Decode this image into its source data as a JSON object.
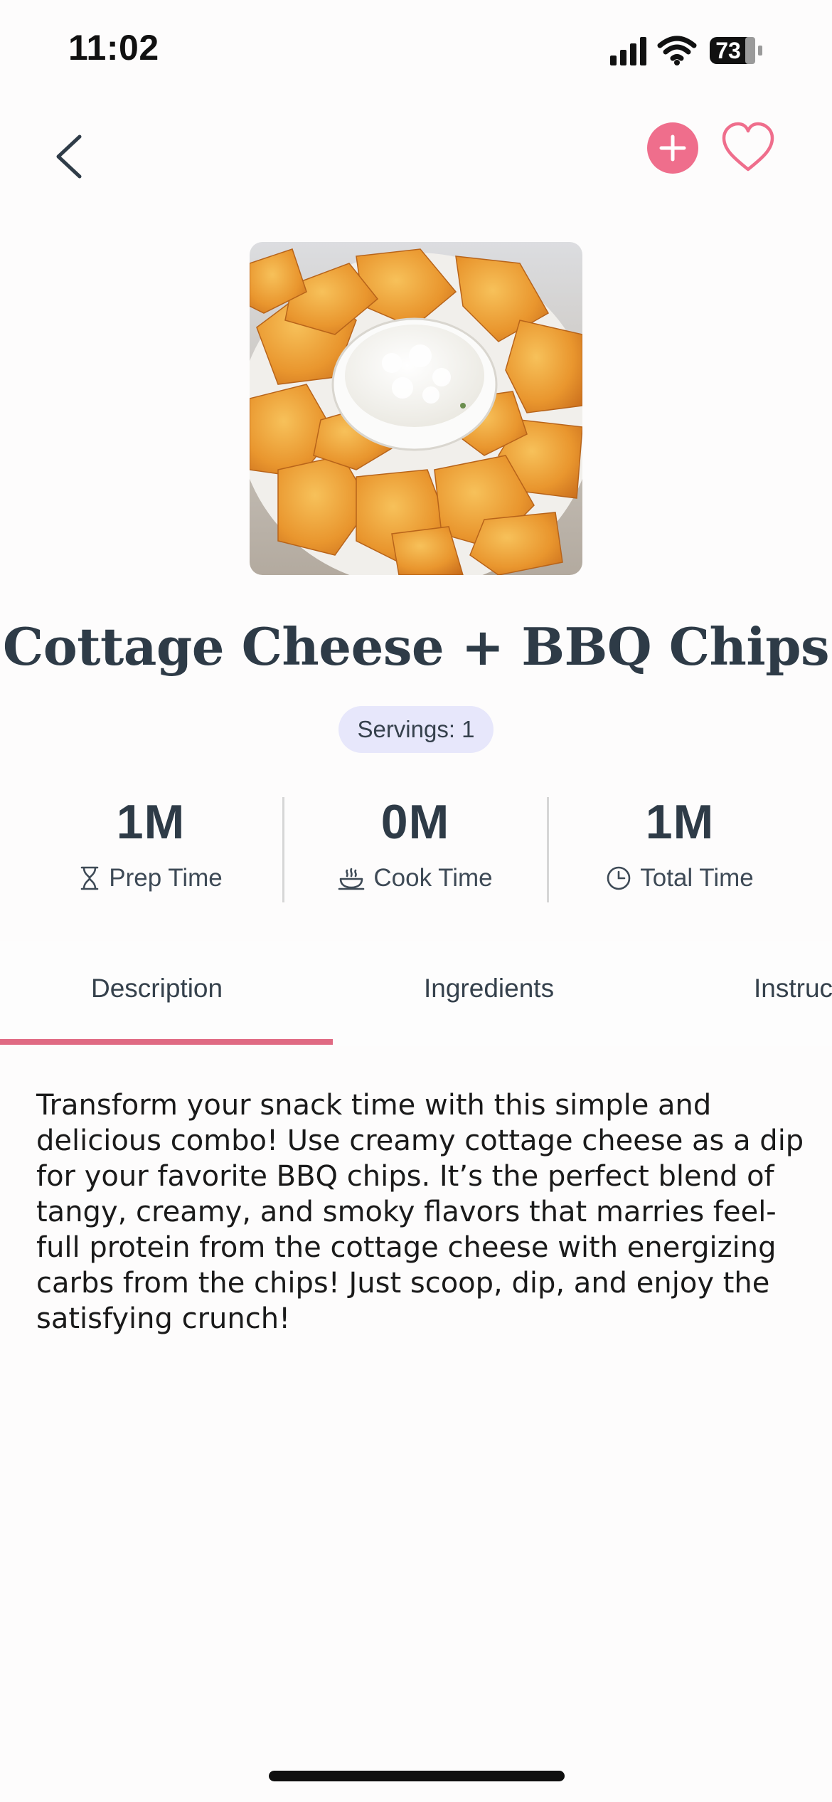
{
  "status_bar": {
    "time": "11:02",
    "battery": "73"
  },
  "nav": {
    "back_icon": "chevron-left-icon",
    "add_icon": "plus-icon",
    "favorite_icon": "heart-outline-icon"
  },
  "recipe": {
    "title": "Cottage Cheese + BBQ Chips",
    "servings": "Servings: 1",
    "image_alt": "Bowl of cottage cheese surrounded by BBQ chips"
  },
  "stats": [
    {
      "value": "1M",
      "label": "Prep Time",
      "icon": "hourglass-icon"
    },
    {
      "value": "0M",
      "label": "Cook Time",
      "icon": "cooking-pot-icon"
    },
    {
      "value": "1M",
      "label": "Total Time",
      "icon": "clock-icon"
    }
  ],
  "tabs": [
    {
      "label": "Description",
      "active": true
    },
    {
      "label": "Ingredients",
      "active": false
    },
    {
      "label": "Instructions",
      "active": false
    }
  ],
  "description": "Transform your snack time with this simple and delicious combo! Use creamy cottage cheese as a dip for your favorite BBQ chips. It’s the perfect blend of tangy, creamy, and smoky flavors that marries feel-full protein from the cottage cheese with energizing carbs from the chips! Just scoop, dip, and enjoy the satisfying crunch!",
  "colors": {
    "accent": "#ef6e8c",
    "tab_indicator": "#e06a83",
    "badge_bg": "#e7e7fb",
    "text_dark": "#2e3b47"
  }
}
